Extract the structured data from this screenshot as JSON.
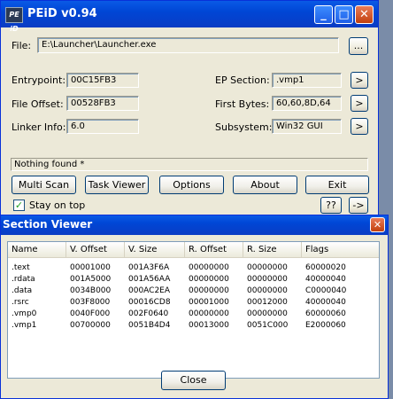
{
  "main_window": {
    "title": "PEiD v0.94",
    "app_icon_text": "PE iD",
    "title_buttons": {
      "minimize": "_",
      "maximize": "□",
      "close": "✕"
    },
    "file": {
      "label": "File:",
      "value": "E:\\Launcher\\Launcher.exe",
      "browse_label": "..."
    },
    "entrypoint": {
      "label": "Entrypoint:",
      "value": "00C15FB3"
    },
    "file_offset": {
      "label": "File Offset:",
      "value": "00528FB3"
    },
    "linker_info": {
      "label": "Linker Info:",
      "value": "6.0"
    },
    "ep_section": {
      "label": "EP Section:",
      "value": ".vmp1",
      "button": ">"
    },
    "first_bytes": {
      "label": "First Bytes:",
      "value": "60,60,8D,64",
      "button": ">"
    },
    "subsystem": {
      "label": "Subsystem:",
      "value": "Win32 GUI",
      "button": ">"
    },
    "status_text": "Nothing found *",
    "buttons": {
      "multi_scan": "Multi Scan",
      "task_viewer": "Task Viewer",
      "options": "Options",
      "about": "About",
      "exit": "Exit"
    },
    "stay_on_top": {
      "label": "Stay on top",
      "checked": true,
      "check_glyph": "✓"
    },
    "help_button": "??",
    "arrow_button": "->"
  },
  "section_viewer": {
    "title": "Section Viewer",
    "close_glyph": "✕",
    "columns": [
      "Name",
      "V. Offset",
      "V. Size",
      "R. Offset",
      "R. Size",
      "Flags"
    ],
    "rows": [
      [
        ".text",
        "00001000",
        "001A3F6A",
        "00000000",
        "00000000",
        "60000020"
      ],
      [
        ".rdata",
        "001A5000",
        "001A56AA",
        "00000000",
        "00000000",
        "40000040"
      ],
      [
        ".data",
        "0034B000",
        "000AC2EA",
        "00000000",
        "00000000",
        "C0000040"
      ],
      [
        ".rsrc",
        "003F8000",
        "00016CD8",
        "00001000",
        "00012000",
        "40000040"
      ],
      [
        ".vmp0",
        "0040F000",
        "002F0640",
        "00000000",
        "00000000",
        "60000060"
      ],
      [
        ".vmp1",
        "00700000",
        "0051B4D4",
        "00013000",
        "0051C000",
        "E2000060"
      ]
    ],
    "close_button": "Close"
  },
  "colors": {
    "titlebar": "#0a5ae6",
    "window_bg": "#ece9d8",
    "desktop": "#7a8ca8"
  }
}
